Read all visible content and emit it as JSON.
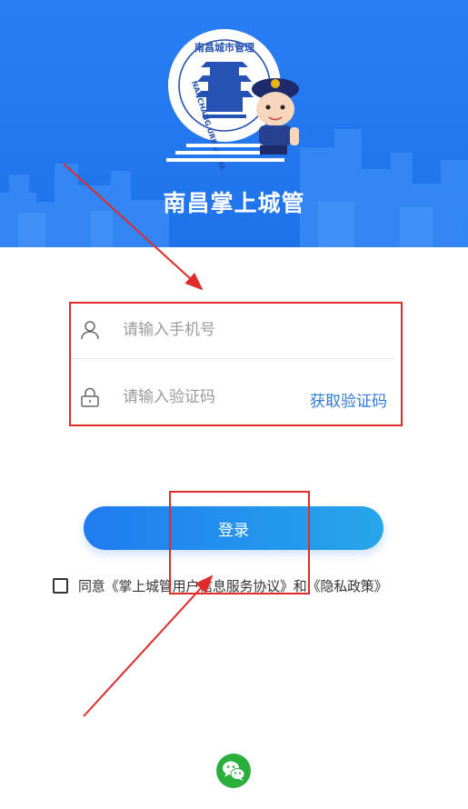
{
  "header": {
    "app_title": "南昌掌上城管",
    "logo_arc_text": "南昌城市管理",
    "logo_side_text": "NANCHANG URBAN MA"
  },
  "form": {
    "phone_placeholder": "请输入手机号",
    "code_placeholder": "请输入验证码",
    "get_code_label": "获取验证码",
    "login_label": "登录"
  },
  "agreement": {
    "checked": false,
    "text": "同意《掌上城管用户信息服务协议》和《隐私政策》"
  },
  "third_party": {
    "icon": "wechat-icon"
  },
  "colors": {
    "header_blue": "#2a7ef5",
    "link_blue": "#2f7bd9",
    "button_start": "#1f7cf0",
    "button_end": "#27a6ea",
    "wechat_green": "#2aae3c",
    "annotation_red": "#e02b2b"
  }
}
